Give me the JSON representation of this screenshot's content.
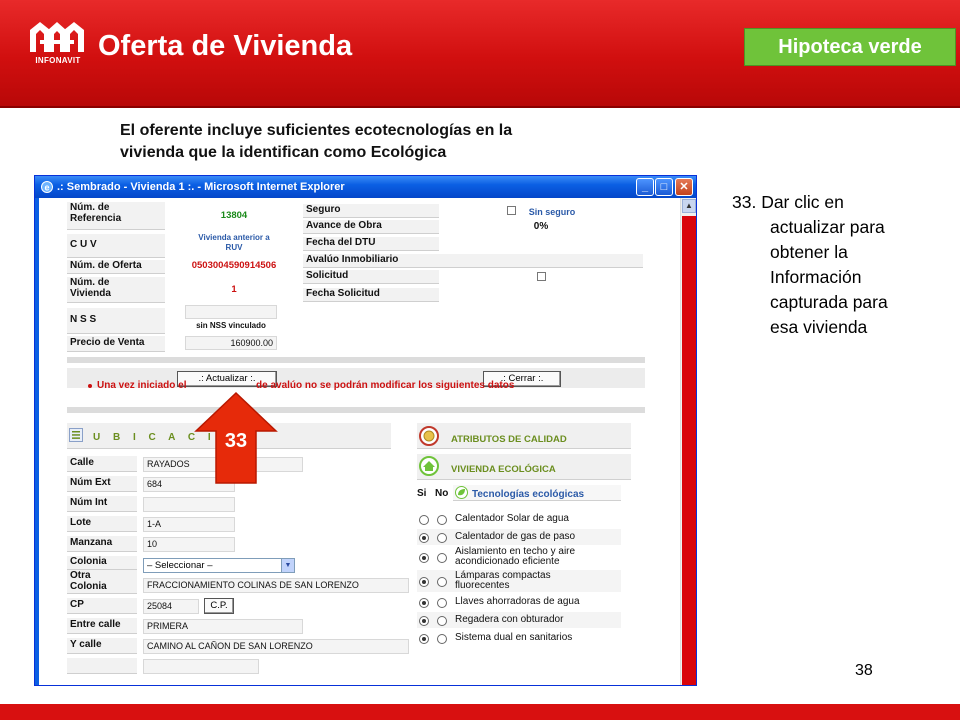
{
  "slide": {
    "title": "Oferta de Vivienda",
    "logo_text": "INFONAVIT",
    "badge": "Hipoteca verde",
    "subtitle_line1": "El oferente incluye suficientes ecotecnologías en la",
    "subtitle_line2": "vivienda que la identifican como Ecológica",
    "instruction_line1": "33. Dar clic en",
    "instruction_rest": [
      "actualizar para",
      "obtener la",
      "Información",
      "capturada para",
      "esa vivienda"
    ],
    "page_number": "38",
    "callout_number": "33",
    "colors": {
      "header_red": "#d10f0f",
      "badge_green": "#6fc33a",
      "arrow_red": "#e62a0a"
    }
  },
  "window": {
    "title": ".: Sembrado - Vivienda 1 :. - Microsoft Internet Explorer",
    "controls": [
      "minimize-icon",
      "maximize-icon",
      "close-icon"
    ]
  },
  "form": {
    "num_referencia_label_1": "Núm. de",
    "num_referencia_label_2": "Referencia",
    "num_referencia_value": "13804",
    "cuv_label": "C U V",
    "cuv_value_1": "Vivienda anterior a",
    "cuv_value_2": "RUV",
    "num_oferta_label": "Núm. de Oferta",
    "num_oferta_value": "0503004590914506",
    "num_vivienda_label_1": "Núm. de",
    "num_vivienda_label_2": "Vivienda",
    "num_vivienda_value": "1",
    "nss_label": "N S S",
    "nss_note": "sin NSS vinculado",
    "precio_label": "Precio de Venta",
    "precio_value": "160900.00",
    "seguro_label": "Seguro",
    "seguro_value": "Sin seguro",
    "avance_label": "Avance de Obra",
    "avance_value": "0%",
    "fecha_dtu_label": "Fecha del DTU",
    "avaluo_label": "Avalúo Inmobiliario",
    "solicitud_label": "Solicitud",
    "fecha_solicitud_label": "Fecha Solicitud",
    "actualizar_button": ".: Actualizar :.",
    "cerrar_button": ".: Cerrar :.",
    "warning_part1": "Una vez iniciado el",
    "warning_part2": "de avalúo no se podrán modificar los siguientes datos"
  },
  "ubicacion": {
    "title": "U B I C A C I Ó N",
    "calle_label": "Calle",
    "calle_value": "RAYADOS",
    "num_ext_label": "Núm Ext",
    "num_ext_value": "684",
    "num_int_label": "Núm Int",
    "lote_label": "Lote",
    "lote_value": "1-A",
    "manzana_label": "Manzana",
    "manzana_value": "10",
    "colonia_label": "Colonia",
    "colonia_select": "– Seleccionar –",
    "otra_colonia_label_1": "Otra",
    "otra_colonia_label_2": "Colonia",
    "otra_colonia_value": "FRACCIONAMIENTO COLINAS DE SAN LORENZO",
    "cp_label": "CP",
    "cp_value": "25084",
    "cp_button": "C.P.",
    "entre_calle_label": "Entre calle",
    "entre_calle_value": "PRIMERA",
    "y_calle_label": "Y calle",
    "y_calle_value": "CAMINO AL CAÑON DE SAN LORENZO"
  },
  "atributos": {
    "calidad_title": "ATRIBUTOS DE CALIDAD",
    "ecologica_title": "VIVIENDA ECOLÓGICA",
    "si_label": "Si",
    "no_label": "No",
    "tecnologias_title": "Tecnologías ecológicas",
    "items": [
      {
        "label_1": "Calentador Solar de agua",
        "label_2": "",
        "si": false,
        "no": false
      },
      {
        "label_1": "Calentador de gas de paso",
        "label_2": "",
        "si": true,
        "no": false
      },
      {
        "label_1": "Aislamiento en techo y aire",
        "label_2": "acondicionado eficiente",
        "si": true,
        "no": false
      },
      {
        "label_1": "Lámparas compactas",
        "label_2": "fluorecentes",
        "si": true,
        "no": false
      },
      {
        "label_1": "Llaves ahorradoras de agua",
        "label_2": "",
        "si": true,
        "no": false
      },
      {
        "label_1": "Regadera con obturador",
        "label_2": "",
        "si": true,
        "no": false
      },
      {
        "label_1": "Sistema dual en sanitarios",
        "label_2": "",
        "si": true,
        "no": false
      }
    ]
  }
}
